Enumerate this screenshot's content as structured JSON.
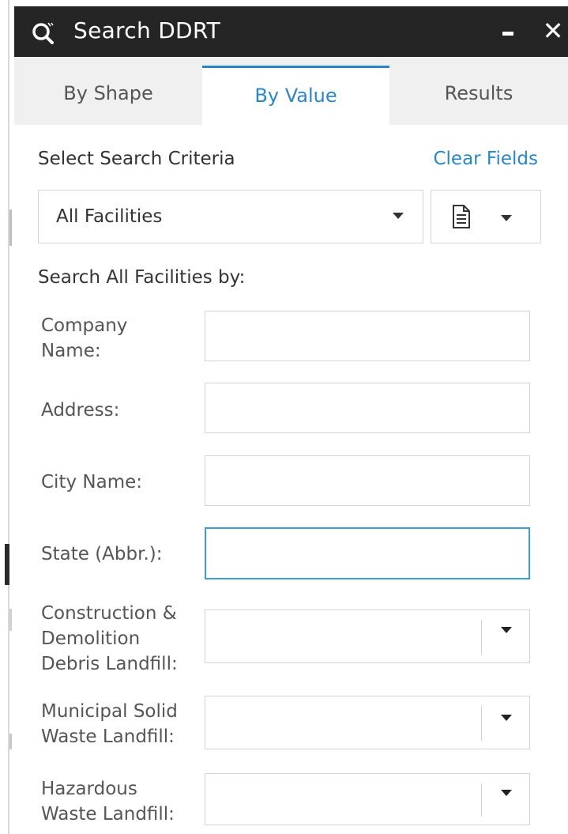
{
  "window": {
    "title": "Search DDRT",
    "minimize_label": "",
    "close_glyph": "✕"
  },
  "tabs": [
    {
      "label": "By Shape",
      "active": false
    },
    {
      "label": "By Value",
      "active": true
    },
    {
      "label": "Results",
      "active": false
    }
  ],
  "criteria": {
    "label": "Select Search Criteria",
    "clear_label": "Clear Fields",
    "selected": "All Facilities"
  },
  "search_by_label": "Search All Facilities by:",
  "fields": {
    "company": {
      "label_line1": "Company",
      "label_line2": "Name:",
      "value": ""
    },
    "address": {
      "label": "Address:",
      "value": ""
    },
    "city": {
      "label": "City Name:",
      "value": ""
    },
    "state": {
      "label": "State (Abbr.):",
      "value": ""
    }
  },
  "dropdowns": {
    "cd_landfill": {
      "label_line1": "Construction &",
      "label_line2": "Demolition",
      "label_line3": "Debris Landfill:",
      "value": ""
    },
    "msw_landfill": {
      "label_line1": "Municipal Solid",
      "label_line2": "Waste Landfill:",
      "value": ""
    },
    "haz_landfill": {
      "label_line1": "Hazardous",
      "label_line2": "Waste Landfill:",
      "value": ""
    }
  },
  "colors": {
    "accent": "#2b86c5",
    "titlebar": "#252525",
    "tab_bg": "#f0f0f0"
  },
  "icons": {
    "title_search": "search-icon",
    "export": "document-icon"
  }
}
